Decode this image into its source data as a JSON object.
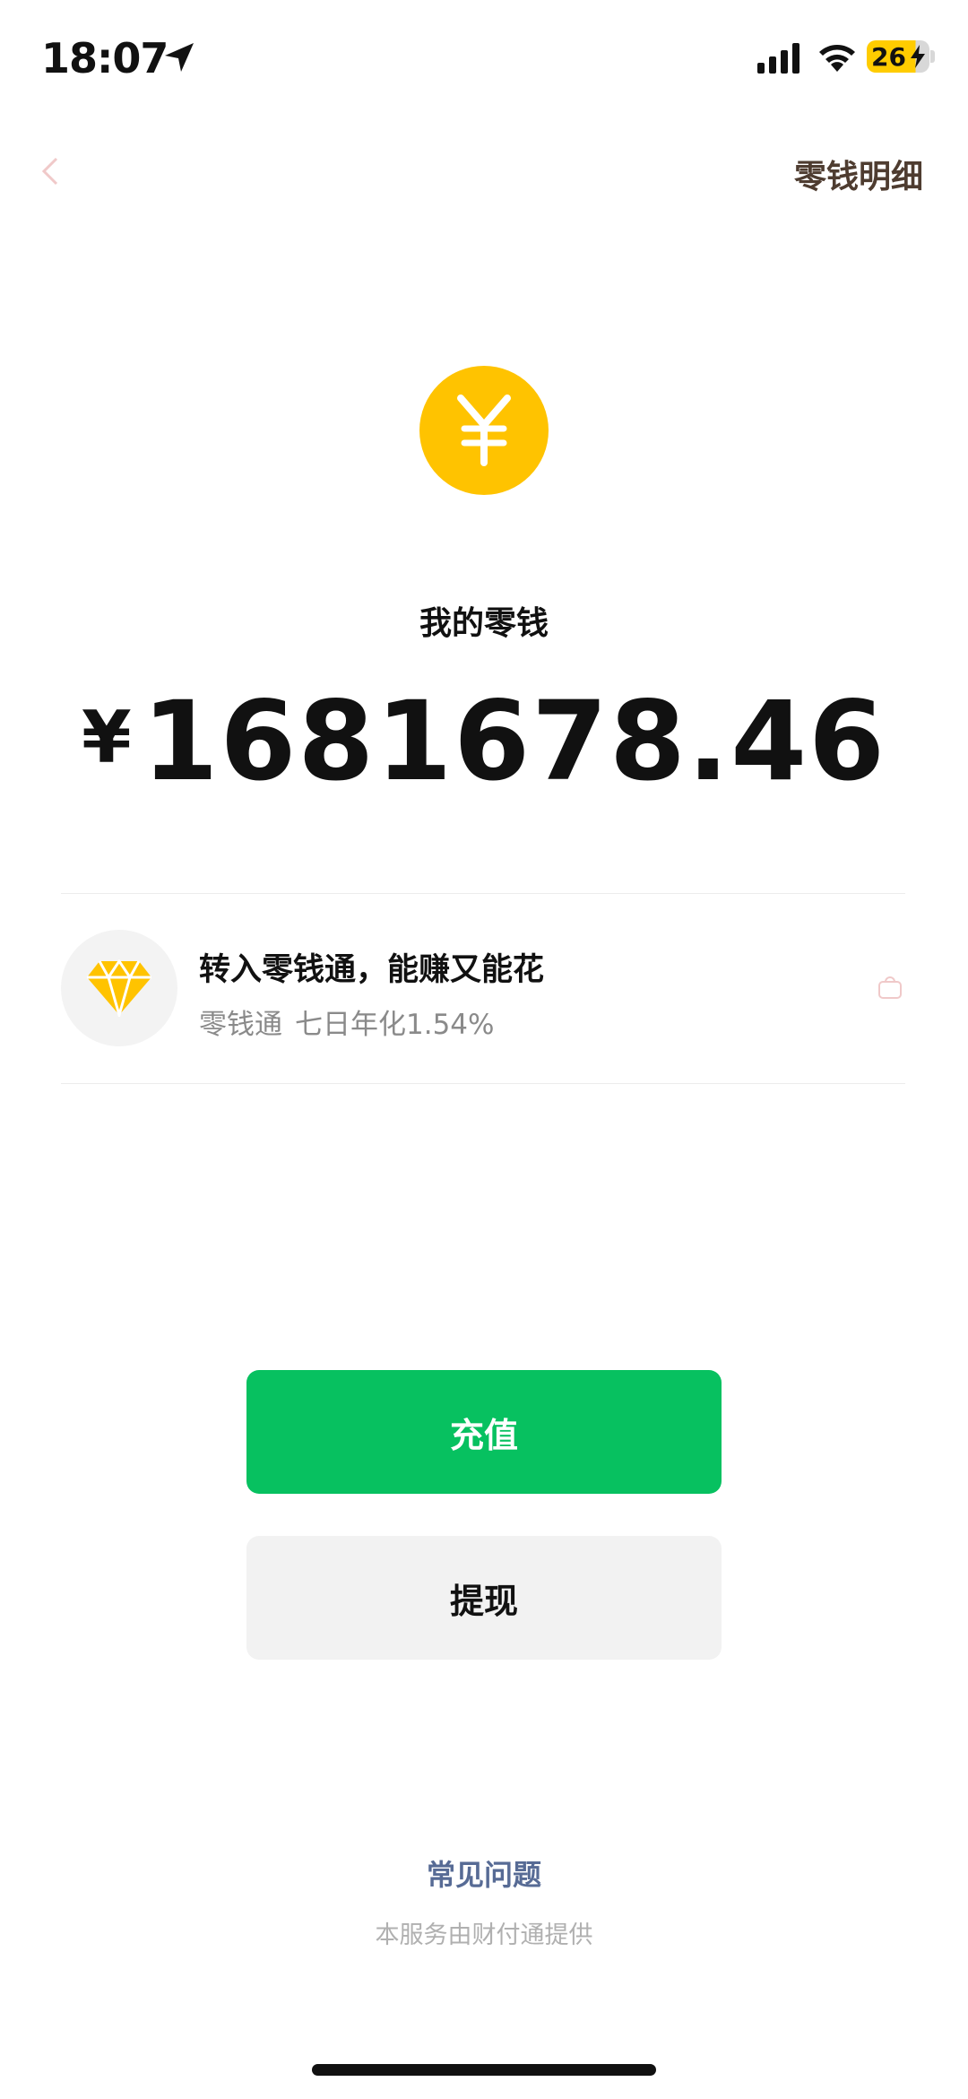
{
  "status_bar": {
    "time": "18:07",
    "battery_level": "26",
    "icons": [
      "location-arrow-icon",
      "signal-bars-icon",
      "wifi-icon",
      "charging-bolt-icon"
    ]
  },
  "header": {
    "back_icon": "back-arrow-icon",
    "detail_link": "零钱明细"
  },
  "wallet": {
    "coin_icon": "yuan-coin-icon",
    "title": "我的零钱",
    "currency_symbol": "¥",
    "balance": "1681678.46"
  },
  "promo": {
    "icon": "diamond-icon",
    "title": "转入零钱通，能赚又能花",
    "product": "零钱通",
    "rate_text": "七日年化1.54%"
  },
  "actions": {
    "topup_label": "充值",
    "withdraw_label": "提现"
  },
  "footer": {
    "faq_link": "常见问题",
    "provider_note": "本服务由财付通提供"
  },
  "colors": {
    "brand_green": "#07c160",
    "coin_yellow": "#ffc300",
    "link_blue": "#576b95",
    "detail_brown": "#4e3c30"
  }
}
